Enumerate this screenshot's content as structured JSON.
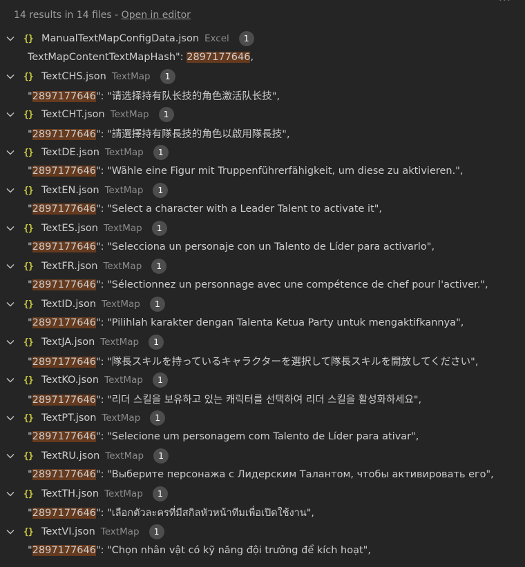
{
  "header": {
    "results_summary": "14 results in 14 files",
    "separator": " - ",
    "open_in_editor": "Open in editor",
    "more_icon": "ellipsis-icon"
  },
  "files": [
    {
      "name": "ManualTextMapConfigData.json",
      "dir": "Excel",
      "count": "1",
      "pre": "TextMapContentTextMapHash\": ",
      "match": "2897177646",
      "post": ","
    },
    {
      "name": "TextCHS.json",
      "dir": "TextMap",
      "count": "1",
      "pre": "\"",
      "match": "2897177646",
      "post": "\": \"请选择持有队长技的角色激活队长技\","
    },
    {
      "name": "TextCHT.json",
      "dir": "TextMap",
      "count": "1",
      "pre": "\"",
      "match": "2897177646",
      "post": "\": \"請選擇持有隊長技的角色以啟用隊長技\","
    },
    {
      "name": "TextDE.json",
      "dir": "TextMap",
      "count": "1",
      "pre": "\"",
      "match": "2897177646",
      "post": "\": \"Wähle eine Figur mit Truppenführerfähigkeit, um diese zu aktivieren.\","
    },
    {
      "name": "TextEN.json",
      "dir": "TextMap",
      "count": "1",
      "pre": "\"",
      "match": "2897177646",
      "post": "\": \"Select a character with a Leader Talent to activate it\","
    },
    {
      "name": "TextES.json",
      "dir": "TextMap",
      "count": "1",
      "pre": "\"",
      "match": "2897177646",
      "post": "\": \"Selecciona un personaje con un Talento de Líder para activarlo\","
    },
    {
      "name": "TextFR.json",
      "dir": "TextMap",
      "count": "1",
      "pre": "\"",
      "match": "2897177646",
      "post": "\": \"Sélectionnez un personnage avec une compétence de chef pour l'activer.\","
    },
    {
      "name": "TextID.json",
      "dir": "TextMap",
      "count": "1",
      "pre": "\"",
      "match": "2897177646",
      "post": "\": \"Pilihlah karakter dengan Talenta Ketua Party untuk mengaktifkannya\","
    },
    {
      "name": "TextJA.json",
      "dir": "TextMap",
      "count": "1",
      "pre": "\"",
      "match": "2897177646",
      "post": "\": \"隊長スキルを持っているキャラクターを選択して隊長スキルを開放してください\","
    },
    {
      "name": "TextKO.json",
      "dir": "TextMap",
      "count": "1",
      "pre": "\"",
      "match": "2897177646",
      "post": "\": \"리더 스킬을 보유하고 있는 캐릭터를 선택하여 리더 스킬을 활성화하세요\","
    },
    {
      "name": "TextPT.json",
      "dir": "TextMap",
      "count": "1",
      "pre": "\"",
      "match": "2897177646",
      "post": "\": \"Selecione um personagem com Talento de Líder para ativar\","
    },
    {
      "name": "TextRU.json",
      "dir": "TextMap",
      "count": "1",
      "pre": "\"",
      "match": "2897177646",
      "post": "\": \"Выберите персонажа с Лидерским Талантом, чтобы активировать его\","
    },
    {
      "name": "TextTH.json",
      "dir": "TextMap",
      "count": "1",
      "pre": "\"",
      "match": "2897177646",
      "post": "\": \"เลือกตัวละครที่มีสกิลหัวหน้าทีมเพื่อเปิดใช้งาน\","
    },
    {
      "name": "TextVI.json",
      "dir": "TextMap",
      "count": "1",
      "pre": "\"",
      "match": "2897177646",
      "post": "\": \"Chọn nhân vật có kỹ năng đội trưởng để kích hoạt\","
    }
  ],
  "colors": {
    "background": "#252526",
    "highlight": "#653a1e",
    "json_icon": "#cbcb41",
    "badge": "#4d4d4d"
  }
}
